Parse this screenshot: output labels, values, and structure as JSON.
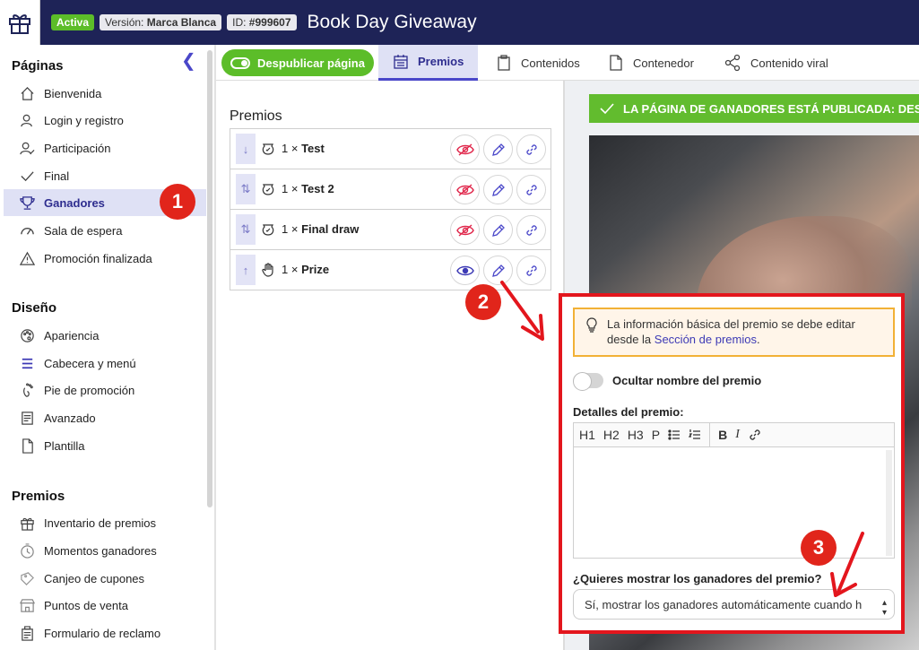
{
  "header": {
    "status_badge": "Activa",
    "version_label": "Versión:",
    "version_value": "Marca Blanca",
    "id_label": "ID:",
    "id_value": "#999607",
    "title": "Book Day Giveaway"
  },
  "sidebar": {
    "sections": [
      {
        "title": "Páginas",
        "items": [
          {
            "label": "Bienvenida",
            "icon": "home-icon"
          },
          {
            "label": "Login y registro",
            "icon": "user-icon"
          },
          {
            "label": "Participación",
            "icon": "user-check-icon"
          },
          {
            "label": "Final",
            "icon": "check-icon"
          },
          {
            "label": "Ganadores",
            "icon": "trophy-icon",
            "active": true
          },
          {
            "label": "Sala de espera",
            "icon": "gauge-icon"
          },
          {
            "label": "Promoción finalizada",
            "icon": "warning-icon"
          }
        ]
      },
      {
        "title": "Diseño",
        "items": [
          {
            "label": "Apariencia",
            "icon": "palette-icon"
          },
          {
            "label": "Cabecera y menú",
            "icon": "menu-icon"
          },
          {
            "label": "Pie de promoción",
            "icon": "footprint-icon"
          },
          {
            "label": "Avanzado",
            "icon": "code-icon"
          },
          {
            "label": "Plantilla",
            "icon": "file-icon"
          }
        ]
      },
      {
        "title": "Premios",
        "items": [
          {
            "label": "Inventario de premios",
            "icon": "gift-icon"
          },
          {
            "label": "Momentos ganadores",
            "icon": "clock-icon"
          },
          {
            "label": "Canjeo de cupones",
            "icon": "coupon-icon"
          },
          {
            "label": "Puntos de venta",
            "icon": "store-icon"
          },
          {
            "label": "Formulario de reclamo",
            "icon": "form-icon"
          }
        ]
      }
    ]
  },
  "tabs": {
    "unpublish": "Despublicar página",
    "items": [
      {
        "label": "Premios",
        "icon": "calendar-icon",
        "active": true
      },
      {
        "label": "Contenidos",
        "icon": "clipboard-icon"
      },
      {
        "label": "Contenedor",
        "icon": "document-icon"
      },
      {
        "label": "Contenido viral",
        "icon": "share-icon"
      }
    ]
  },
  "prizes": {
    "title": "Premios",
    "rows": [
      {
        "qty": "1 ×",
        "name": "Test",
        "sort": "↓",
        "visible": false
      },
      {
        "qty": "1 ×",
        "name": "Test 2",
        "sort": "⇅",
        "visible": false
      },
      {
        "qty": "1 ×",
        "name": "Final draw",
        "sort": "⇅",
        "visible": false
      },
      {
        "qty": "1 ×",
        "name": "Prize",
        "sort": "↑",
        "visible": true
      }
    ]
  },
  "preview": {
    "published_banner": "LA PÁGINA DE GANADORES ESTÁ PUBLICADA: DES"
  },
  "editor_panel": {
    "info_text": "La información básica del premio se debe editar desde la",
    "info_link": "Sección de premios",
    "info_end": ".",
    "hide_name_label": "Ocultar nombre del premio",
    "details_label": "Detalles del premio:",
    "toolbar": [
      "H1",
      "H2",
      "H3",
      "P"
    ],
    "show_winners_label": "¿Quieres mostrar los ganadores del premio?",
    "show_winners_value": "Sí, mostrar los ganadores automáticamente cuando h"
  },
  "annotations": {
    "step1": "1",
    "step2": "2",
    "step3": "3"
  },
  "colors": {
    "header_bg": "#1e2357",
    "accent": "#4a47c9",
    "green": "#5cbd29",
    "annotation_red": "#e3161d"
  }
}
